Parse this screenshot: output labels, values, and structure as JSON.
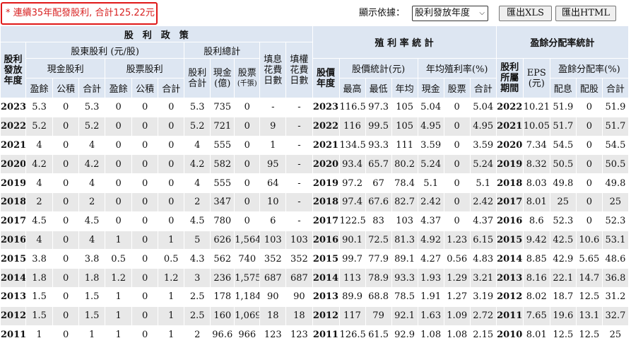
{
  "summary": "* 連續35年配發股利, 合計125.22元",
  "controls": {
    "display_by_label": "顯示依據：",
    "display_by_value": "股利發放年度",
    "export_xls": "匯出XLS",
    "export_html": "匯出HTML"
  },
  "headers": {
    "dividend_policy": "股　利　政　策",
    "yield_stats": "殖 利 率 統 計",
    "payout_stats": "盈餘分配率統計",
    "div_year": "股利\n發放\n年度",
    "shareholder_div": "股東股利 (元/股)",
    "div_total": "股利總計",
    "ex_div_days": "填息\n花費\n日數",
    "ex_right_days": "填權\n花費\n日數",
    "cash_div": "現金股利",
    "stock_div": "股票股利",
    "div_sum": "股利\n合計",
    "cash_total": "現金\n(億)",
    "stock_total": "股票",
    "stock_total_unit": "(千張)",
    "earnings": "盈餘",
    "reserve": "公積",
    "subtotal": "合計",
    "yield_year": "股價\n年度",
    "price_stats": "股價統計(元)",
    "avg_yield": "年均殖利率(%)",
    "high": "最高",
    "low": "最低",
    "avg": "年均",
    "cash": "現金",
    "stock": "股票",
    "total": "合計",
    "earn_period": "股利\n所屬\n期間",
    "eps": "EPS\n(元)",
    "payout_ratio": "盈餘分配率(%)",
    "cash_payout": "配息",
    "stock_payout": "配股",
    "payout_total": "合計"
  },
  "rows": [
    [
      "2023",
      "5.3",
      "0",
      "5.3",
      "0",
      "0",
      "0",
      "5.3",
      "735",
      "0",
      "-",
      "-",
      "2023",
      "116.5",
      "97.3",
      "105",
      "5.04",
      "0",
      "5.04",
      "2022",
      "10.21",
      "51.9",
      "0",
      "51.9"
    ],
    [
      "2022",
      "5.2",
      "0",
      "5.2",
      "0",
      "0",
      "0",
      "5.2",
      "721",
      "0",
      "9",
      "-",
      "2022",
      "116",
      "99.5",
      "105",
      "4.95",
      "0",
      "4.95",
      "2021",
      "10.05",
      "51.7",
      "0",
      "51.7"
    ],
    [
      "2021",
      "4",
      "0",
      "4",
      "0",
      "0",
      "0",
      "4",
      "555",
      "0",
      "1",
      "-",
      "2021",
      "134.5",
      "93.3",
      "111",
      "3.59",
      "0",
      "3.59",
      "2020",
      "7.34",
      "54.5",
      "0",
      "54.5"
    ],
    [
      "2020",
      "4.2",
      "0",
      "4.2",
      "0",
      "0",
      "0",
      "4.2",
      "582",
      "0",
      "95",
      "-",
      "2020",
      "93.4",
      "65.7",
      "80.2",
      "5.24",
      "0",
      "5.24",
      "2019",
      "8.32",
      "50.5",
      "0",
      "50.5"
    ],
    [
      "2019",
      "4",
      "0",
      "4",
      "0",
      "0",
      "0",
      "4",
      "555",
      "0",
      "64",
      "-",
      "2019",
      "97.2",
      "67",
      "78.4",
      "5.1",
      "0",
      "5.1",
      "2018",
      "8.03",
      "49.8",
      "0",
      "49.8"
    ],
    [
      "2018",
      "2",
      "0",
      "2",
      "0",
      "0",
      "0",
      "2",
      "347",
      "0",
      "10",
      "-",
      "2018",
      "97.4",
      "67.6",
      "82.7",
      "2.42",
      "0",
      "2.42",
      "2017",
      "8.01",
      "25",
      "0",
      "25"
    ],
    [
      "2017",
      "4.5",
      "0",
      "4.5",
      "0",
      "0",
      "0",
      "4.5",
      "780",
      "0",
      "6",
      "-",
      "2017",
      "122.5",
      "83",
      "103",
      "4.37",
      "0",
      "4.37",
      "2016",
      "8.6",
      "52.3",
      "0",
      "52.3"
    ],
    [
      "2016",
      "4",
      "0",
      "4",
      "1",
      "0",
      "1",
      "5",
      "626",
      "1,564",
      "103",
      "103",
      "2016",
      "90.1",
      "72.5",
      "81.3",
      "4.92",
      "1.23",
      "6.15",
      "2015",
      "9.42",
      "42.5",
      "10.6",
      "53.1"
    ],
    [
      "2015",
      "3.8",
      "0",
      "3.8",
      "0.5",
      "0",
      "0.5",
      "4.3",
      "562",
      "740",
      "352",
      "352",
      "2015",
      "99.7",
      "77.9",
      "89.1",
      "4.27",
      "0.56",
      "4.83",
      "2014",
      "8.85",
      "42.9",
      "5.65",
      "48.6"
    ],
    [
      "2014",
      "1.8",
      "0",
      "1.8",
      "1.2",
      "0",
      "1.2",
      "3",
      "236",
      "1,575",
      "687",
      "687",
      "2014",
      "113",
      "78.9",
      "93.3",
      "1.93",
      "1.29",
      "3.21",
      "2013",
      "8.16",
      "22.1",
      "14.7",
      "36.8"
    ],
    [
      "2013",
      "1.5",
      "0",
      "1.5",
      "1",
      "0",
      "1",
      "2.5",
      "178",
      "1,184",
      "90",
      "90",
      "2013",
      "89.9",
      "68.8",
      "78.5",
      "1.91",
      "1.27",
      "3.19",
      "2012",
      "8.02",
      "18.7",
      "12.5",
      "31.2"
    ],
    [
      "2012",
      "1.5",
      "0",
      "1.5",
      "1",
      "0",
      "1",
      "2.5",
      "160",
      "1,069",
      "18",
      "18",
      "2012",
      "117",
      "79",
      "92.1",
      "1.63",
      "1.09",
      "2.72",
      "2011",
      "7.65",
      "19.6",
      "13.1",
      "32.7"
    ],
    [
      "2011",
      "1",
      "0",
      "1",
      "1",
      "0",
      "1",
      "2",
      "96.6",
      "966",
      "123",
      "123",
      "2011",
      "126.5",
      "61.5",
      "92.9",
      "1.08",
      "1.08",
      "2.15",
      "2010",
      "8.01",
      "12.5",
      "12.5",
      "25"
    ]
  ]
}
